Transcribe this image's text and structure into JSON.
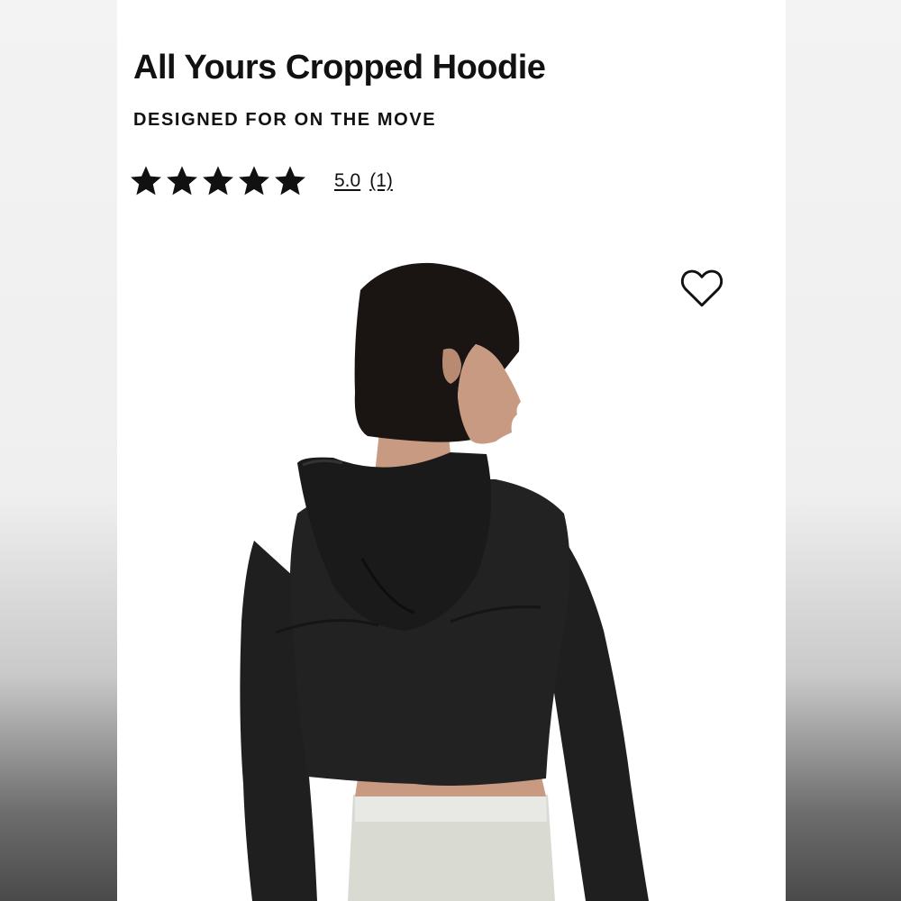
{
  "product": {
    "title": "All Yours Cropped Hoodie",
    "tagline": "DESIGNED FOR ON THE MOVE",
    "rating": {
      "stars_filled": 5,
      "stars_total": 5,
      "score": "5.0",
      "count": "(1)"
    },
    "wishlist_icon": "heart-outline-icon",
    "image_subject": "model-back-view-black-cropped-hoodie"
  },
  "colors": {
    "hoodie": "#202020",
    "hair": "#1a1513",
    "skin": "#c89a82",
    "pants": "#d9dbd3"
  }
}
